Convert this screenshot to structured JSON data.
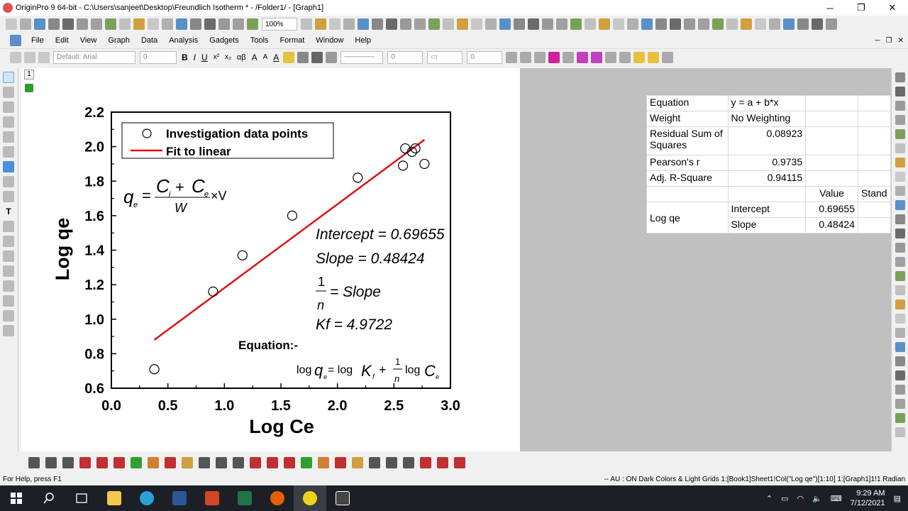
{
  "window": {
    "title": "OriginPro 9 64-bit - C:\\Users\\sanjeet\\Desktop\\Freundlich Isotherm * - /Folder1/ - [Graph1]",
    "minimize": "─",
    "restore": "❐",
    "close": "✕"
  },
  "toolbar": {
    "zoom": "100%",
    "font": "Default: Arial",
    "font_size": "0",
    "line_width": "0",
    "pattern_size": "0"
  },
  "menu": {
    "items": [
      "File",
      "Edit",
      "View",
      "Graph",
      "Data",
      "Analysis",
      "Gadgets",
      "Tools",
      "Format",
      "Window",
      "Help"
    ]
  },
  "layer": {
    "number": "1"
  },
  "graph": {
    "legend": {
      "points": "Investigation data points",
      "fit": "Fit to linear"
    },
    "equation_label": "Equation:-"
  },
  "chart_data": {
    "type": "scatter",
    "xlabel": "Log Ce",
    "ylabel": "Log qe",
    "xlim": [
      0.0,
      3.0
    ],
    "ylim": [
      0.6,
      2.2
    ],
    "x_ticks": [
      "0.0",
      "0.5",
      "1.0",
      "1.5",
      "2.0",
      "2.5",
      "3.0"
    ],
    "y_ticks": [
      "0.6",
      "0.8",
      "1.0",
      "1.2",
      "1.4",
      "1.6",
      "1.8",
      "2.0",
      "2.2"
    ],
    "series": [
      {
        "name": "Investigation data points",
        "marker": "open-circle",
        "points": [
          {
            "x": 0.38,
            "y": 0.71
          },
          {
            "x": 0.9,
            "y": 1.16
          },
          {
            "x": 1.16,
            "y": 1.37
          },
          {
            "x": 1.6,
            "y": 1.6
          },
          {
            "x": 2.18,
            "y": 1.82
          },
          {
            "x": 2.58,
            "y": 1.89
          },
          {
            "x": 2.6,
            "y": 1.99
          },
          {
            "x": 2.66,
            "y": 1.97
          },
          {
            "x": 2.69,
            "y": 1.99
          },
          {
            "x": 2.77,
            "y": 1.9
          }
        ]
      },
      {
        "name": "Fit to linear",
        "color": "#e01010",
        "points": [
          {
            "x": 0.38,
            "y": 0.88
          },
          {
            "x": 2.77,
            "y": 2.04
          }
        ]
      }
    ],
    "legend_position": "top-left"
  },
  "annotations": {
    "qe_formula": {
      "lhs": "q",
      "lhs_sub": "e",
      "num_a": "C",
      "num_a_sub": "i",
      "plus": "+",
      "num_b": "C",
      "num_b_sub": "e",
      "den": "W",
      "times": "×V"
    },
    "intercept": "Intercept = 0.69655",
    "slope": "Slope = 0.48424",
    "one": "1",
    "n": "n",
    "eq_slope": "= Slope",
    "kf": "Kf = 4.9722",
    "eq_log1": "log",
    "eq_q": "q",
    "eq_q_sub": "e",
    "eq_mid": " = log",
    "eq_K": "K",
    "eq_K_sub": "f",
    "eq_plus": "+",
    "eq_log2": "log",
    "eq_C": "C",
    "eq_C_sub": "e"
  },
  "stats_table": {
    "equation_label": "Equation",
    "equation_value": "y = a + b*x",
    "weight_label": "Weight",
    "weight_value": "No Weighting",
    "rss_label": "Residual Sum of Squares",
    "rss_value": "0.08923",
    "pearson_label": "Pearson's r",
    "pearson_value": "0.9735",
    "adjr_label": "Adj. R-Square",
    "adjr_value": "0.94115",
    "value_header": "Value",
    "stderr_header": "Stand",
    "param_group": "Log qe",
    "intercept_label": "Intercept",
    "intercept_value": "0.69655",
    "slope_label": "Slope",
    "slope_value": "0.48424"
  },
  "status": {
    "help": "For Help, press F1",
    "right": "-- AU : ON  Dark Colors & Light Grids  1:[Book1]Sheet1!Col(\"Log qe\")[1:10]  1:[Graph1]1!1  Radian"
  },
  "taskbar": {
    "time": "9:29 AM",
    "date": "7/12/2021"
  },
  "colors": {
    "fit_line": "#e01010",
    "gray_area": "#c0c0c0",
    "taskbar": "#1c2026"
  }
}
